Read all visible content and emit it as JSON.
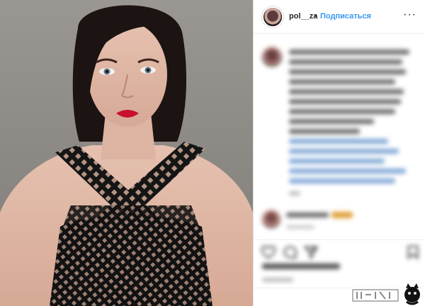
{
  "header": {
    "username": "pol__za",
    "separator": "•",
    "follow_label": "Подписаться",
    "more_icon": "more-horizontal-icon"
  },
  "colors": {
    "link": "#3897f0",
    "text": "#262626",
    "photo_background": "#8e8b87",
    "dress": "#1a1a1a",
    "lips": "#c8102e"
  },
  "actions": {
    "like_icon": "heart-icon",
    "comment_icon": "comment-icon",
    "share_icon": "share-icon",
    "save_icon": "bookmark-icon"
  }
}
